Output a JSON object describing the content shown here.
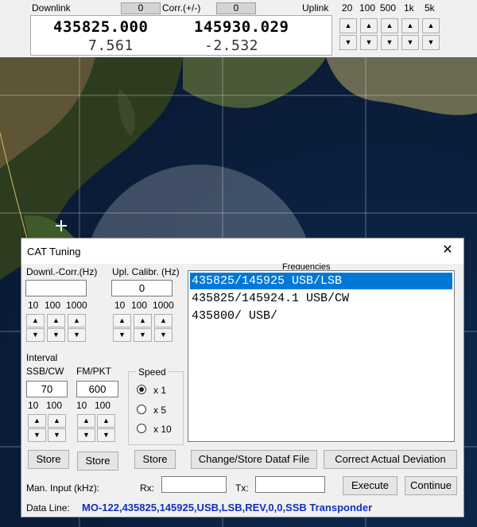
{
  "topbar": {
    "downlink_label": "Downlink",
    "corr_label": "Corr.(+/-)",
    "uplink_label": "Uplink",
    "corr_down_value": "0",
    "corr_up_value": "0",
    "step_labels": [
      "20",
      "100",
      "500",
      "1k",
      "5k"
    ],
    "downlink_freq": "435825.000",
    "uplink_freq": "145930.029",
    "downlink_doppler": "7.561",
    "uplink_doppler": "-2.532"
  },
  "cat_window": {
    "title": "CAT Tuning",
    "close_symbol": "✕",
    "downl_corr_label": "Downl.-Corr.(Hz)",
    "downl_corr_value": "",
    "upl_calib_label": "Upl. Calibr. (Hz)",
    "upl_calib_value": "0",
    "corr_steps": [
      "10",
      "100",
      "1000"
    ],
    "calib_steps": [
      "10",
      "100",
      "1000"
    ],
    "frequencies_label": "Frequencies",
    "frequency_list": [
      "435825/145925 USB/LSB",
      "435825/145924.1 USB/CW",
      "435800/ USB/"
    ],
    "selected_index": 0,
    "interval_label": "Interval",
    "ssb_cw_label": "SSB/CW",
    "fm_pkt_label": "FM/PKT",
    "ssb_cw_value": "70",
    "fm_pkt_value": "600",
    "ssb_steps": [
      "10",
      "100"
    ],
    "fm_steps": [
      "10",
      "100"
    ],
    "speed_label": "Speed",
    "speed_options": [
      "x 1",
      "x 5",
      "x 10"
    ],
    "speed_selected": 0,
    "store_label": "Store",
    "change_store_label": "Change/Store Dataf File",
    "correct_deviation_label": "Correct Actual Deviation",
    "man_input_label": "Man. Input (kHz):",
    "rx_label": "Rx:",
    "tx_label": "Tx:",
    "rx_value": "",
    "tx_value": "",
    "execute_label": "Execute",
    "continue_label": "Continue",
    "data_line_label": "Data Line:",
    "data_line_value": "MO-122,435825,145925,USB,LSB,REV,0,0,SSB Transponder",
    "data_line_color": "#1030c0"
  },
  "icons": {
    "up": "▲",
    "down": "▼"
  },
  "colors": {
    "selection": "#0078d7",
    "window_bg": "#f0f0f0",
    "ocean": "#0b1f3c"
  }
}
